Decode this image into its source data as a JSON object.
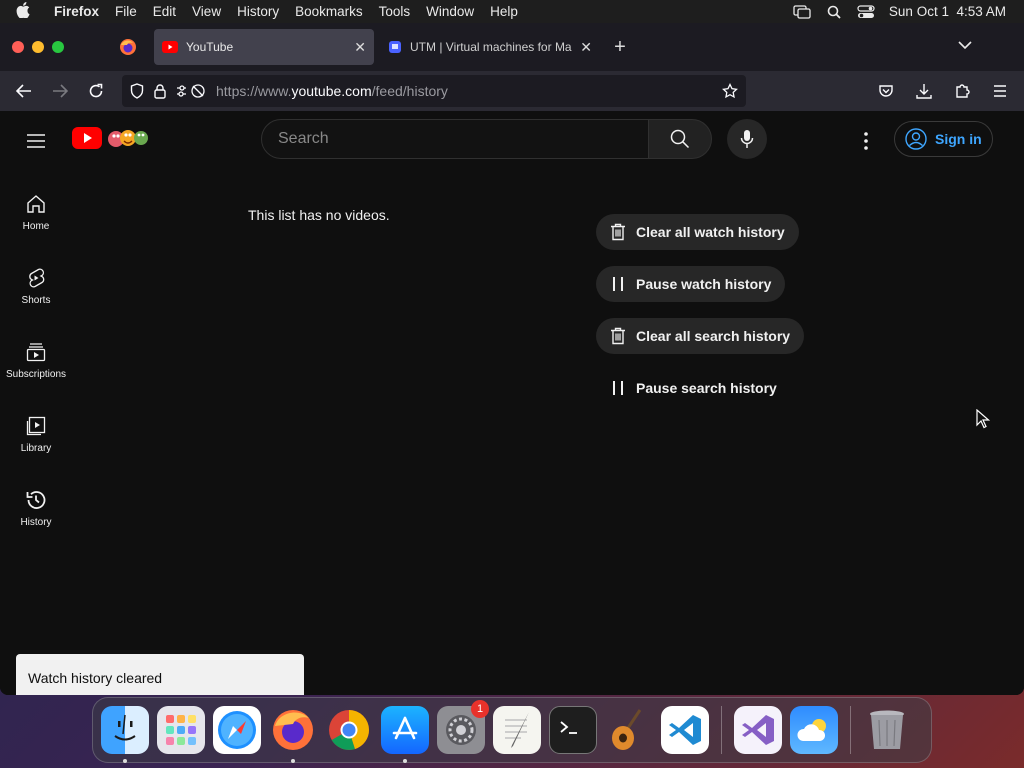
{
  "menubar": {
    "app_name": "Firefox",
    "items": [
      "File",
      "Edit",
      "View",
      "History",
      "Bookmarks",
      "Tools",
      "Window",
      "Help"
    ],
    "clock": "Sun Oct 1  4:53 AM"
  },
  "browser": {
    "tabs": [
      {
        "title": "YouTube",
        "active": true
      },
      {
        "title": "UTM | Virtual machines for Mac",
        "active": false
      }
    ],
    "new_tab_symbol": "+",
    "url": {
      "prefix": "https://www.",
      "domain": "youtube.com",
      "path": "/feed/history"
    }
  },
  "youtube": {
    "search_placeholder": "Search",
    "sign_in_label": "Sign in",
    "sidebar": [
      {
        "label": "Home",
        "icon": "home-icon"
      },
      {
        "label": "Shorts",
        "icon": "shorts-icon"
      },
      {
        "label": "Subscriptions",
        "icon": "subscriptions-icon"
      },
      {
        "label": "Library",
        "icon": "library-icon"
      },
      {
        "label": "History",
        "icon": "history-icon"
      }
    ],
    "empty_message": "This list has no videos.",
    "actions": [
      {
        "label": "Clear all watch history",
        "icon": "trash-icon"
      },
      {
        "label": "Pause watch history",
        "icon": "pause-icon"
      },
      {
        "label": "Clear all search history",
        "icon": "trash-icon"
      },
      {
        "label": "Pause search history",
        "icon": "pause-icon"
      }
    ],
    "toast": "Watch history cleared",
    "accent_color": "#3ea6ff",
    "brand_red": "#ff0000"
  },
  "dock": {
    "apps": [
      "Finder",
      "Launchpad",
      "Safari",
      "Firefox",
      "Chrome",
      "App Store",
      "System Settings",
      "TextEdit",
      "Terminal",
      "GarageBand",
      "VS Code",
      "Visual Studio",
      "Weather",
      "Trash"
    ],
    "settings_badge": "1"
  }
}
